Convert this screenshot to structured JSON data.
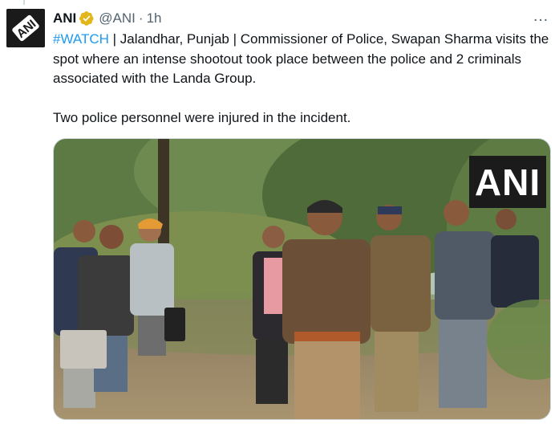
{
  "tweet": {
    "author_name": "ANI",
    "handle": "@ANI",
    "separator": "·",
    "time": "1h",
    "hashtag": "#WATCH",
    "line1_rest": " | Jalandhar, Punjab | Commissioner of Police, Swapan Sharma visits the spot where an intense shootout took place between the police and 2 criminals associated with the Landa Group.",
    "line2": "Two police personnel were injured in the incident.",
    "more_icon": "…",
    "avatar_logo_text": "ANI"
  },
  "media": {
    "watermark": "ANI"
  },
  "colors": {
    "accent": "#1d9bf0",
    "verified_gold": "#e2b719",
    "muted": "#536471",
    "border": "#cfd9de"
  },
  "icons": [
    "verified-badge-icon",
    "more-options-icon"
  ]
}
